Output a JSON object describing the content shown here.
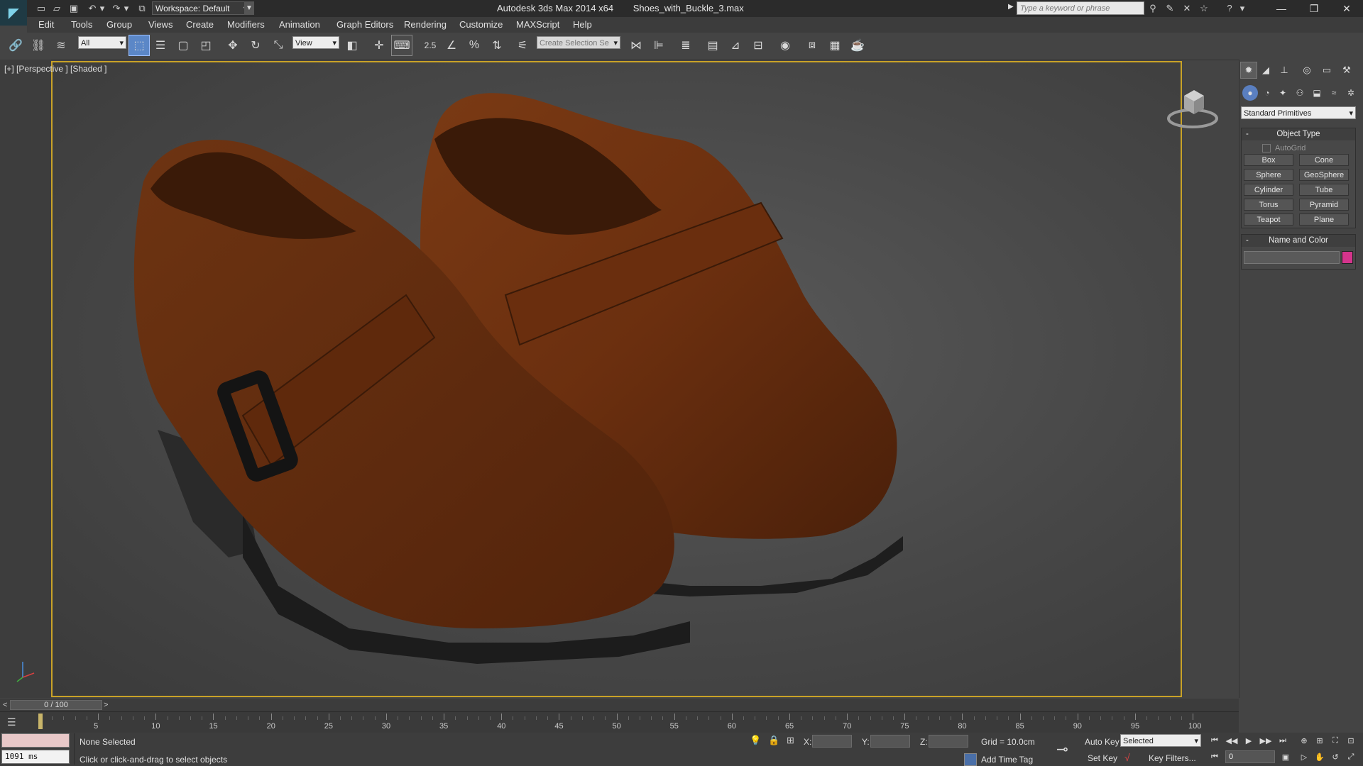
{
  "titlebar": {
    "app_title": "Autodesk 3ds Max  2014 x64",
    "file_name": "Shoes_with_Buckle_3.max",
    "workspace_label": "Workspace: Default",
    "search_placeholder": "Type a keyword or phrase"
  },
  "menu": [
    "Edit",
    "Tools",
    "Group",
    "Views",
    "Create",
    "Modifiers",
    "Animation",
    "Graph Editors",
    "Rendering",
    "Customize",
    "MAXScript",
    "Help"
  ],
  "toolbar": {
    "selection_filter": "All",
    "reference_coord": "View",
    "snap_value": "2.5",
    "named_selection_placeholder": "Create Selection Se"
  },
  "viewport": {
    "label": "[+] [Perspective ] [Shaded ]"
  },
  "command_panel": {
    "category": "Standard Primitives",
    "object_type_title": "Object Type",
    "autogrid_label": "AutoGrid",
    "primitives": [
      "Box",
      "Cone",
      "Sphere",
      "GeoSphere",
      "Cylinder",
      "Tube",
      "Torus",
      "Pyramid",
      "Teapot",
      "Plane"
    ],
    "name_color_title": "Name and Color",
    "swatch_color": "#d4348c"
  },
  "timeline": {
    "frame_readout": "0 / 100",
    "prev_label": "<",
    "next_label": ">",
    "ticks": [
      "5",
      "10",
      "15",
      "20",
      "25",
      "30",
      "35",
      "40",
      "45",
      "50",
      "55",
      "60",
      "65",
      "70",
      "75",
      "80",
      "85",
      "90",
      "95",
      "100"
    ]
  },
  "statusbar": {
    "render_time": "1091 ms",
    "selection_status": "None Selected",
    "prompt": "Click or click-and-drag to select objects",
    "x_label": "X:",
    "y_label": "Y:",
    "z_label": "Z:",
    "grid": "Grid = 10.0cm",
    "add_time_tag": "Add Time Tag",
    "auto_key": "Auto Key",
    "set_key": "Set Key",
    "key_mode": "Selected",
    "key_filters": "Key Filters...",
    "current_frame": "0"
  },
  "colors": {
    "viewport_border": "#c9a227",
    "active_tool": "#5b87c7"
  }
}
